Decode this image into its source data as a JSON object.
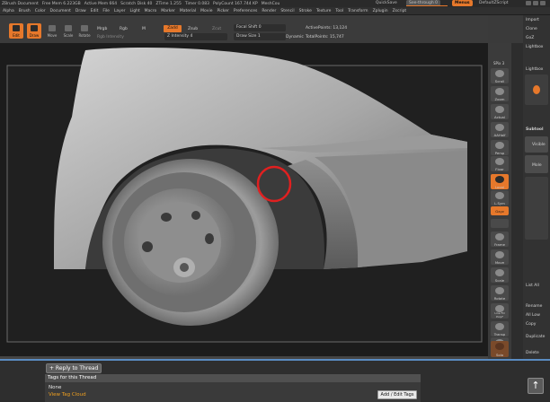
{
  "titlebar": {
    "app": "ZBrush Document",
    "mem_free": "Free Mem 6.223GB",
    "active_mem": "Active Mem 664",
    "scratch_disk": "Scratch Disk 40",
    "ztime": "ZTime 1.255",
    "timer": "Timer 0.083",
    "polycount": "PolyCount 167.744 KP",
    "meshcount": "MeshCou",
    "quicksave": "QuickSave",
    "see_through": "See-through 0",
    "menus": "Menus",
    "default_script": "DefaultZScript"
  },
  "menubar": [
    "Alpha",
    "Brush",
    "Color",
    "Document",
    "Draw",
    "Edit",
    "File",
    "Layer",
    "Light",
    "Macro",
    "Marker",
    "Material",
    "Movie",
    "Picker",
    "Preferences",
    "Render",
    "Stencil",
    "Stroke",
    "Texture",
    "Tool",
    "Transform",
    "Zplugin",
    "Zscript"
  ],
  "toolbar": {
    "edit": "Edit",
    "draw": "Draw",
    "move": "Move",
    "scale": "Scale",
    "rotate": "Rotate",
    "mrgb": "Mrgb",
    "rgb": "Rgb",
    "m": "M",
    "rgb_intensity": "Rgb Intensity",
    "zadd": "Zadd",
    "zsub": "Zsub",
    "zcut": "Zcut",
    "z_intensity": "Z Intensity 4",
    "focal_shift": "Focal Shift 0",
    "draw_size": "Draw Size 1",
    "dynamic": "Dynamic",
    "active_points": "ActivePoints: 13,124",
    "total_points": "TotalPoints: 15,747"
  },
  "right_col": {
    "spix": "SPix 3",
    "buttons": [
      "Scroll",
      "Zoom",
      "Actual",
      "AAHalf",
      "Persp",
      "Floor",
      "Local",
      "L.Sym",
      "Gxyz",
      "",
      "Frame",
      "Move",
      "Scale",
      "Rotate",
      "Line Fill PolyF",
      "Transp",
      "Dynamic",
      "Solo"
    ]
  },
  "tray": {
    "import": "Import",
    "clone": "Clone",
    "goz": "GoZ",
    "lightbox": "Lightbox",
    "lightbox2": "Lightbox",
    "items": [
      "Subtool",
      "Visible",
      "Mole",
      "List All",
      "Rename",
      "All Low",
      "Copy",
      "Duplicate",
      "Delete"
    ]
  },
  "forum": {
    "reply_button": "+ Reply to Thread",
    "tags_title": "Tags for this Thread",
    "tags_none": "None",
    "view_tag_cloud": "View Tag Cloud",
    "add_edit_tags": "Add / Edit Tags"
  },
  "colors": {
    "accent": "#e6782b",
    "link": "#f0a020",
    "highlight_circle": "#e02020"
  }
}
